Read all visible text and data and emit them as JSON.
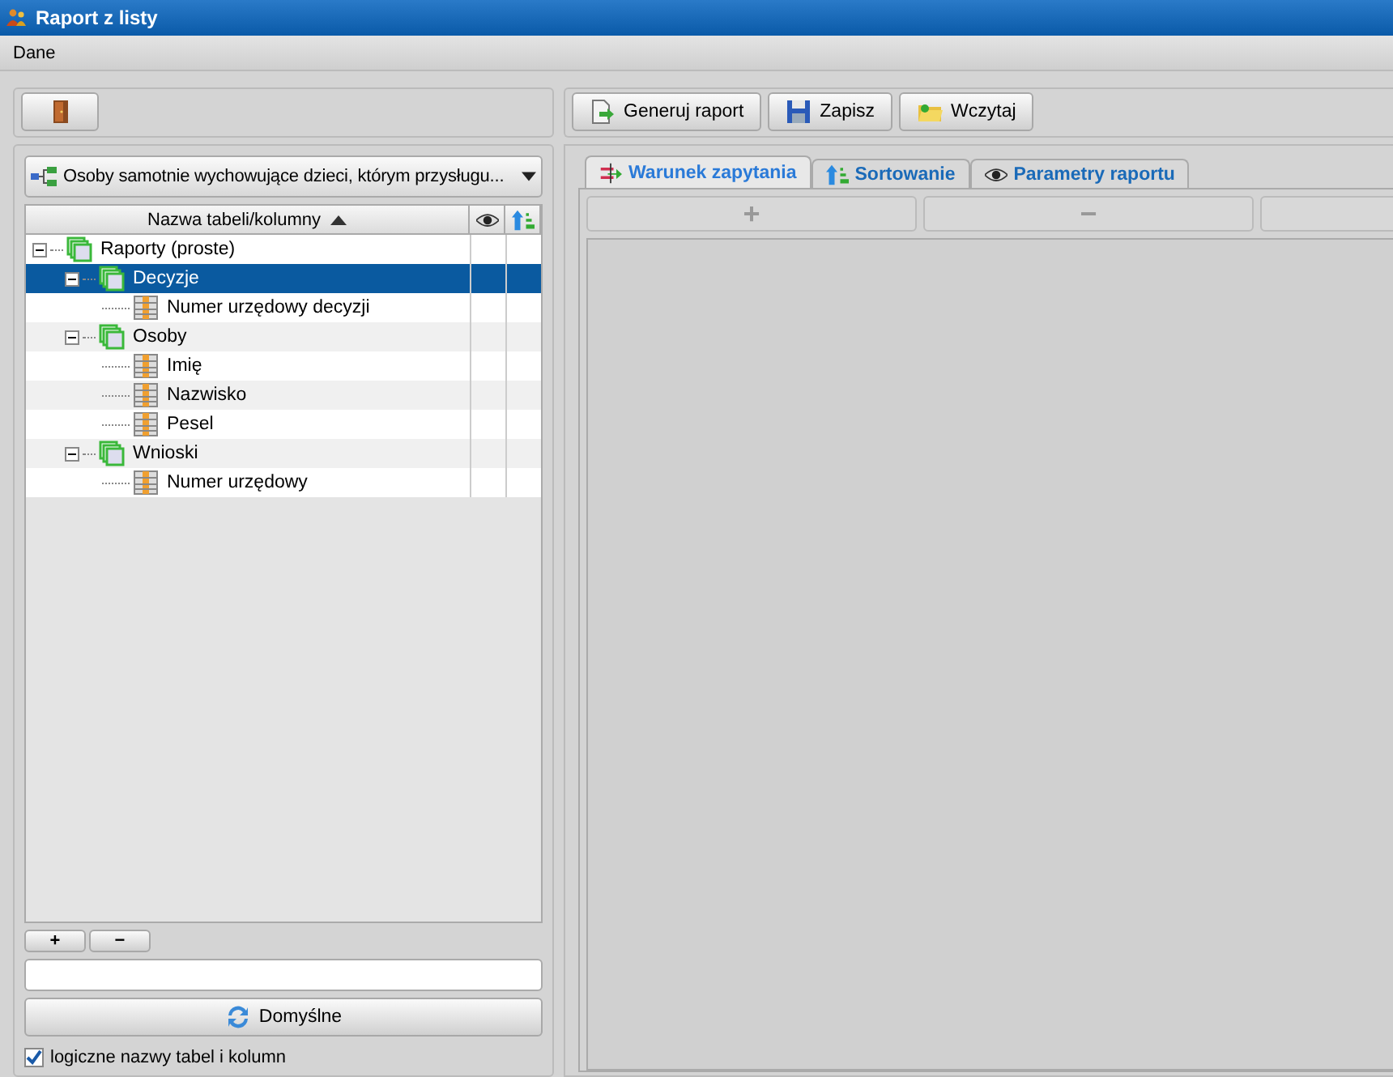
{
  "window": {
    "title": "Raport z listy"
  },
  "menu": [
    "Dane"
  ],
  "toolbar": {
    "buttons": [
      {
        "label": "Generuj raport",
        "kind": "generate"
      },
      {
        "label": "Zapisz",
        "kind": "save"
      },
      {
        "label": "Wczytaj",
        "kind": "load"
      }
    ]
  },
  "report_select": {
    "value": "Osoby samotnie wychowujące dzieci, którym przysługu..."
  },
  "tree": {
    "columns": [
      "Nazwa tabeli/kolumny"
    ],
    "items": [
      {
        "name": "Raporty (proste)",
        "kind": "table",
        "expanded": true,
        "selected": false,
        "children": [
          {
            "name": "Decyzje",
            "kind": "table",
            "expanded": true,
            "selected": true,
            "children": [
              {
                "name": "Numer urzędowy decyzji",
                "kind": "column",
                "selected": false
              }
            ]
          },
          {
            "name": "Osoby",
            "kind": "table",
            "expanded": true,
            "selected": false,
            "children": [
              {
                "name": "Imię",
                "kind": "column",
                "selected": false
              },
              {
                "name": "Nazwisko",
                "kind": "column",
                "selected": false
              },
              {
                "name": "Pesel",
                "kind": "column",
                "selected": false
              }
            ]
          },
          {
            "name": "Wnioski",
            "kind": "table",
            "expanded": true,
            "selected": false,
            "children": [
              {
                "name": "Numer urzędowy",
                "kind": "column",
                "selected": false
              }
            ]
          }
        ]
      }
    ]
  },
  "small_buttons": [
    "+",
    "−"
  ],
  "defaults_button": "Domyślne",
  "logical_names": {
    "label": "logiczne nazwy tabel i kolumn",
    "checked": true
  },
  "tabs": [
    {
      "label": "Warunek zapytania",
      "kind": "condition",
      "selected": true
    },
    {
      "label": "Sortowanie",
      "kind": "sort",
      "selected": false
    },
    {
      "label": "Parametry raportu",
      "kind": "params",
      "selected": false
    }
  ],
  "condition_buttons": [
    "+",
    "−"
  ]
}
